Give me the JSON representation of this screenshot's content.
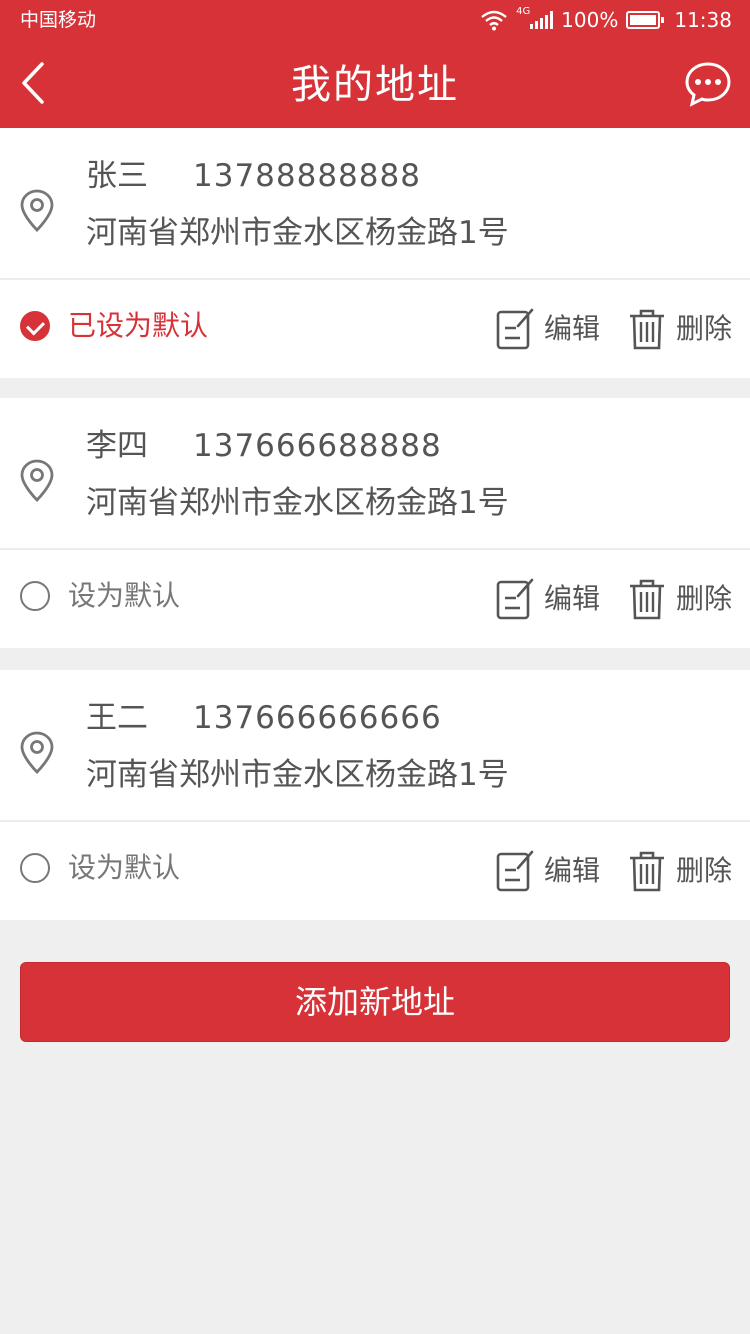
{
  "status_bar": {
    "carrier": "中国移动",
    "network": "4G",
    "battery": "100%",
    "time": "11:38"
  },
  "header": {
    "title": "我的地址"
  },
  "addresses": [
    {
      "name": "张三",
      "phone": "13788888888",
      "address": "河南省郑州市金水区杨金路1号",
      "default_label": "已设为默认",
      "is_default": true,
      "edit_label": "编辑",
      "delete_label": "删除"
    },
    {
      "name": "李四",
      "phone": "137666688888",
      "address": "河南省郑州市金水区杨金路1号",
      "default_label": "设为默认",
      "is_default": false,
      "edit_label": "编辑",
      "delete_label": "删除"
    },
    {
      "name": "王二",
      "phone": "137666666666",
      "address": "河南省郑州市金水区杨金路1号",
      "default_label": "设为默认",
      "is_default": false,
      "edit_label": "编辑",
      "delete_label": "删除"
    }
  ],
  "add_button": "添加新地址",
  "colors": {
    "brand": "#d63237",
    "text": "#555555",
    "muted": "#777777",
    "background": "#efefef"
  }
}
